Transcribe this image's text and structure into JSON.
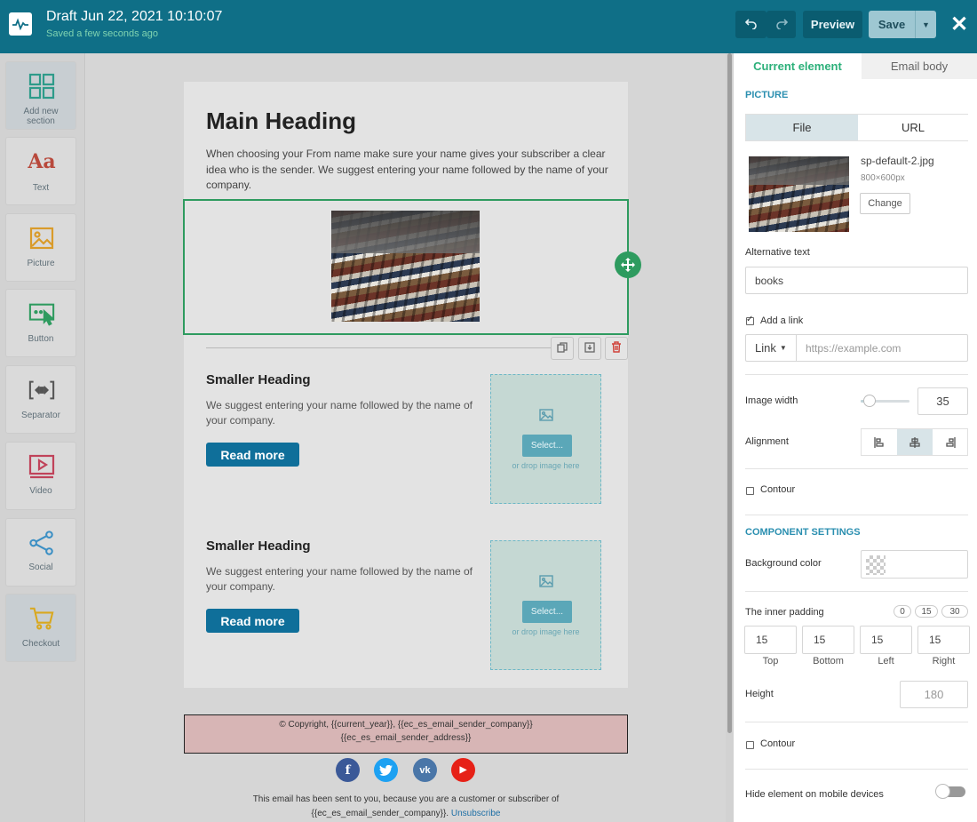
{
  "header": {
    "title": "Draft Jun 22, 2021 10:10:07",
    "saved_status": "Saved a few seconds ago",
    "undo_icon": "undo-icon",
    "redo_icon": "redo-icon",
    "preview_label": "Preview",
    "save_label": "Save",
    "close_icon": "close-icon",
    "brand_color": "#0f6f87"
  },
  "tools": [
    {
      "label": "Add new section",
      "icon": "grid-icon",
      "color": "#2e9b8a"
    },
    {
      "label": "Text",
      "icon": "text-icon",
      "color": "#b8493c"
    },
    {
      "label": "Picture",
      "icon": "image-icon",
      "color": "#d99b2a"
    },
    {
      "label": "Button",
      "icon": "button-icon",
      "color": "#2e9b5f"
    },
    {
      "label": "Separator",
      "icon": "separator-icon",
      "color": "#555555"
    },
    {
      "label": "Video",
      "icon": "video-icon",
      "color": "#c0435a"
    },
    {
      "label": "Social",
      "icon": "share-icon",
      "color": "#3b8fc4"
    },
    {
      "label": "Checkout",
      "icon": "cart-icon",
      "color": "#d9a81e"
    }
  ],
  "email": {
    "main_heading": "Main Heading",
    "intro_text": "When choosing your From name make sure your name gives your subscriber a clear idea who is the sender. We suggest entering your name followed by the name of your company.",
    "blocks": [
      {
        "heading": "Smaller Heading",
        "text": "We suggest entering your name followed by the name of your company.",
        "button": "Read more",
        "select_label": "Select...",
        "drop_text": "or drop image here"
      },
      {
        "heading": "Smaller Heading",
        "text": "We suggest entering your name followed by the name of your company.",
        "button": "Read more",
        "select_label": "Select...",
        "drop_text": "or drop image here"
      }
    ],
    "footer_line1": "© Copyright, {{current_year}}, {{ec_es_email_sender_company}} ",
    "footer_line2": "{{ec_es_email_sender_address}}",
    "footnote_line1": "This email has been sent to you, because you are a customer or subscriber of",
    "footnote_line2": "{{ec_es_email_sender_company}}.",
    "unsubscribe": "Unsubscribe",
    "social": [
      {
        "icon": "facebook-icon",
        "glyph": "f",
        "color": "#3b5998"
      },
      {
        "icon": "twitter-icon",
        "glyph": "🐦",
        "color": "#1da1f2"
      },
      {
        "icon": "vk-icon",
        "glyph": "vk",
        "color": "#4a76a8"
      },
      {
        "icon": "youtube-icon",
        "glyph": "▶",
        "color": "#e62117"
      }
    ]
  },
  "panel": {
    "tab_current": "Current element",
    "tab_body": "Email body",
    "picture_title": "PICTURE",
    "file_tab": "File",
    "url_tab": "URL",
    "file_name": "sp-default-2.jpg",
    "file_size": "800×600px",
    "change_label": "Change",
    "alt_label": "Alternative text",
    "alt_value": "books",
    "add_link_label": "Add a link",
    "link_type": "Link",
    "link_placeholder": "https://example.com",
    "image_width_label": "Image width",
    "image_width_value": "35",
    "image_width_percent": 35,
    "alignment_label": "Alignment",
    "alignment_selected": "center",
    "contour_label": "Contour",
    "component_title": "COMPONENT SETTINGS",
    "bg_color_label": "Background color",
    "inner_padding_label": "The inner padding",
    "padding_presets": [
      "0",
      "15",
      "30"
    ],
    "padding": [
      {
        "label": "Top",
        "value": "15"
      },
      {
        "label": "Bottom",
        "value": "15"
      },
      {
        "label": "Left",
        "value": "15"
      },
      {
        "label": "Right",
        "value": "15"
      }
    ],
    "height_label": "Height",
    "height_placeholder": "180",
    "contour2_label": "Contour",
    "hide_mobile_label": "Hide element on mobile devices"
  }
}
